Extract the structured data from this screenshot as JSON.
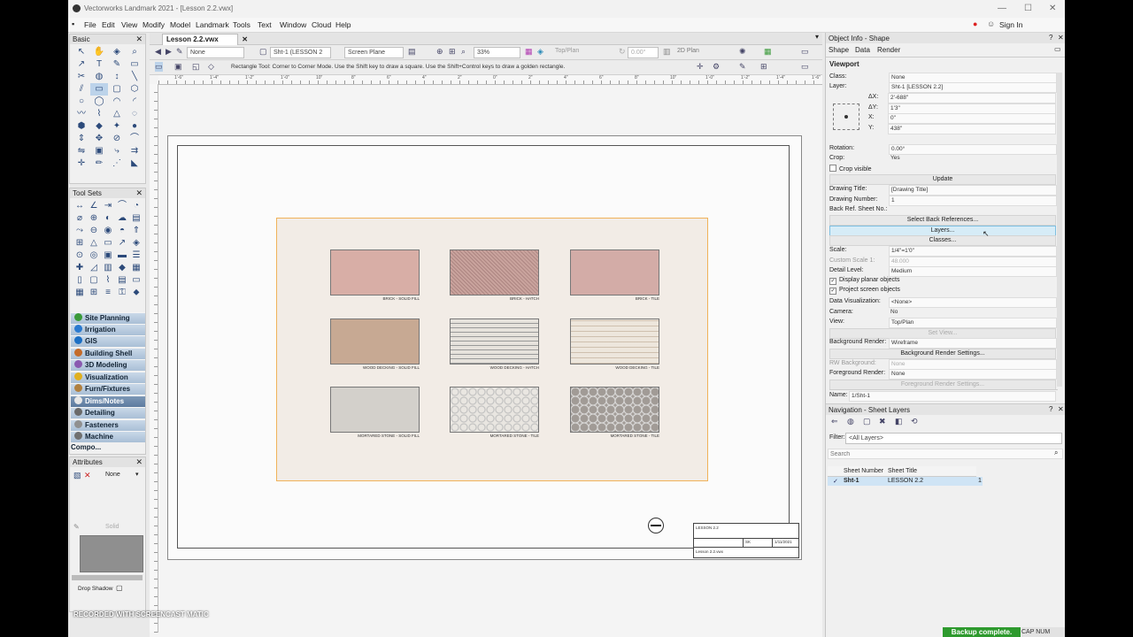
{
  "window": {
    "title": "Vectorworks Landmark 2021 - [Lesson 2.2.vwx]",
    "minimize": "—",
    "maximize": "☐",
    "close": "✕"
  },
  "menu": {
    "items": [
      "File",
      "Edit",
      "View",
      "Modify",
      "Model",
      "Landmark",
      "Tools",
      "Text",
      "Window",
      "Cloud",
      "Help"
    ],
    "sign_in": "Sign In"
  },
  "basic_palette": {
    "title": "Basic"
  },
  "tool_sets": {
    "title": "Tool Sets",
    "items": [
      "Site Planning",
      "Irrigation",
      "GIS",
      "Building Shell",
      "3D Modeling",
      "Visualization",
      "Furn/Fixtures",
      "Dims/Notes",
      "Detailing",
      "Fasteners",
      "Machine Compo..."
    ],
    "active": "Dims/Notes"
  },
  "attributes": {
    "title": "Attributes",
    "fill": "None",
    "pen": "Solid",
    "drop_shadow": "Drop Shadow"
  },
  "document": {
    "tab": "Lesson 2.2.vwx",
    "class_dropdown": "None",
    "layer_dropdown": "Sht-1 (LESSON 2",
    "plane_dropdown": "Screen Plane",
    "zoom": "33%",
    "view": "Top/Plan",
    "rotation": "0.00°",
    "render": "2D Plan",
    "mode_hint": "Rectangle Tool: Corner to Corner Mode. Use the Shift key to draw a square. Use the Shift+Control keys to draw a golden rectangle.",
    "ruler_labels": [
      "1'-6\"",
      "1'-4\"",
      "1'-2\"",
      "1'-0\"",
      "10\"",
      "8\"",
      "6\"",
      "4\"",
      "2\"",
      "0\"",
      "2\"",
      "4\"",
      "6\"",
      "8\"",
      "10\"",
      "1'-0\"",
      "1'-2\"",
      "1'-4\"",
      "1'-6\""
    ]
  },
  "swatches": [
    {
      "label": "BRICK - SOLID FILL",
      "color": "#d8aea6"
    },
    {
      "label": "BRICK - HATCH",
      "color": "#c9a39d"
    },
    {
      "label": "BRICK - TILE",
      "color": "#d3aca7"
    },
    {
      "label": "WOOD DECKING - SOLID FILL",
      "color": "#c7a993"
    },
    {
      "label": "WOOD DECKING - HATCH",
      "color": "#e6e2dc"
    },
    {
      "label": "WOOD DECKING - TILE",
      "color": "#ede6dc"
    },
    {
      "label": "MORTARED STONE - SOLID FILL",
      "color": "#d3d0cb"
    },
    {
      "label": "MORTARED STONE - TILE",
      "color": "#e9e6e1"
    },
    {
      "label": "MORTARED STONE - TILE",
      "color": "#a19b96"
    }
  ],
  "title_block": {
    "title": "LESSON 2.2",
    "initials": "SK",
    "date": "1/11/2021",
    "file": "Lesson 2.2.vwx"
  },
  "object_info": {
    "title": "Object Info - Shape",
    "tabs": [
      "Shape",
      "Data",
      "Render"
    ],
    "object_type": "Viewport",
    "class": "None",
    "layer": "Sht-1 [LESSON 2.2]",
    "dx": "2'-688\"",
    "dy": "1'3\"",
    "x": "0\"",
    "y": "438\"",
    "rotation": "0.00°",
    "crop": "Yes",
    "crop_visible": "Crop visible",
    "update": "Update",
    "drawing_title": "[Drawing Title]",
    "drawing_number": "1",
    "back_ref": "Back Ref. Sheet No.:",
    "select_back_refs": "Select Back References...",
    "layers_btn": "Layers...",
    "classes_btn": "Classes...",
    "scale": "1/4\"=1'0\"",
    "custom_scale": "48.000",
    "detail_level": "Medium",
    "display_planar": "Display planar objects",
    "project_screen": "Project screen objects",
    "data_visualization": "<None>",
    "camera": "No",
    "view": "Top/Plan",
    "set_view": "Set View...",
    "background_render": "Wireframe",
    "background_render_settings": "Background Render Settings...",
    "rw_background": "None",
    "foreground_render": "None",
    "foreground_render_settings": "Foreground Render Settings...",
    "name": "1/Sht-1",
    "labels": {
      "class": "Class:",
      "layer": "Layer:",
      "dx": "ΔX:",
      "dy": "ΔY:",
      "x": "X:",
      "y": "Y:",
      "rotation": "Rotation:",
      "crop": "Crop:",
      "drawing_title": "Drawing Title:",
      "drawing_number": "Drawing Number:",
      "scale": "Scale:",
      "custom_scale": "Custom Scale 1:",
      "detail_level": "Detail Level:",
      "data_visualization": "Data Visualization:",
      "camera": "Camera:",
      "view": "View:",
      "background_render": "Background Render:",
      "rw_background": "RW Background:",
      "foreground_render": "Foreground Render:",
      "name": "Name:"
    }
  },
  "navigation": {
    "title": "Navigation - Sheet Layers",
    "filter_label": "Filter:",
    "filter_value": "<All Layers>",
    "search_placeholder": "Search",
    "columns": [
      "Sheet Number",
      "Sheet Title"
    ],
    "rows": [
      {
        "number": "Sht-1",
        "title": "LESSON 2.2",
        "count": "1"
      }
    ]
  },
  "status": {
    "backup": "Backup complete.",
    "keys": "CAP NUM SCRL"
  },
  "watermark": "RECORDED WITH SCREENCAST MATIC"
}
